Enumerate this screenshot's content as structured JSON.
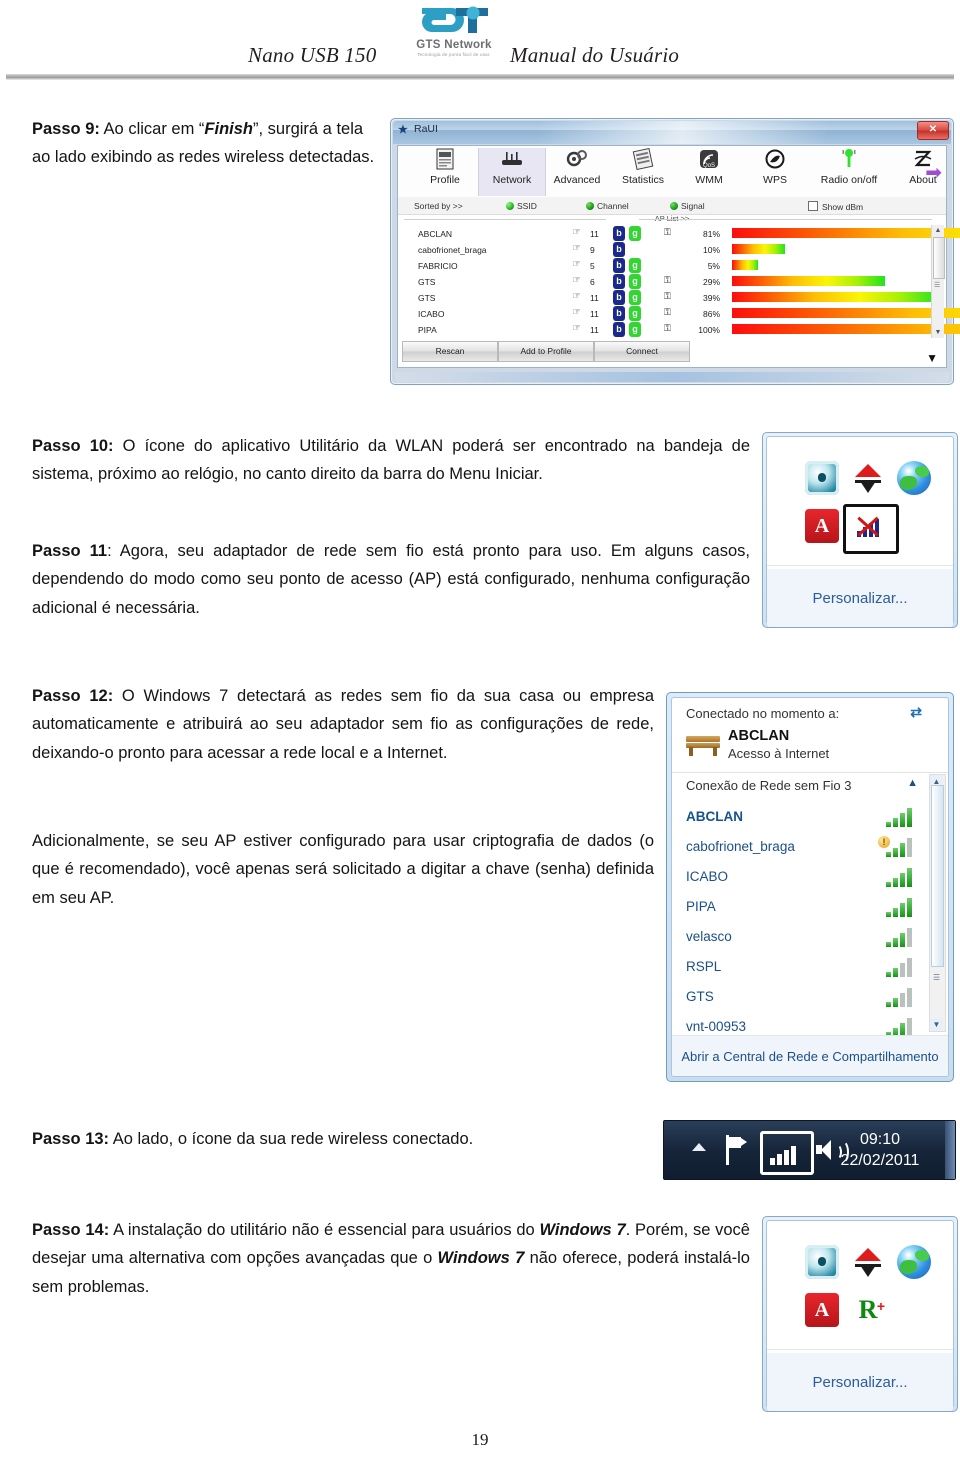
{
  "header": {
    "left_title": "Nano USB 150",
    "right_title": "Manual do Usuário",
    "logo_text": "GTS Network",
    "logo_tagline": "Tecnologia de ponta fácil de usar."
  },
  "steps": {
    "step9": {
      "label": "Passo 9:",
      "text_a": " Ao clicar em “",
      "emph": "Finish",
      "text_b": "”, surgirá a tela ao lado exibindo as redes wireless detectadas."
    },
    "step10": {
      "label": "Passo 10:",
      "text": " O ícone do aplicativo Utilitário da WLAN poderá ser encontrado na bandeja de sistema, próximo ao relógio, no canto direito da barra do Menu Iniciar."
    },
    "step11": {
      "label": "Passo 11",
      "text": ": Agora, seu adaptador de rede sem fio está pronto para uso. Em alguns casos, dependendo do modo como seu ponto de acesso (AP) está configurado, nenhuma configuração adicional é necessária."
    },
    "step12": {
      "label": "Passo 12:",
      "text": " O Windows 7 detectará as redes sem fio da sua casa ou empresa automaticamente e atribuirá ao seu adaptador sem fio as configurações de rede, deixando-o pronto para acessar a rede local e a Internet.",
      "para2": "Adicionalmente, se seu AP estiver configurado para usar criptografia de dados (o que é recomendado), você apenas será solicitado a digitar a chave (senha) definida em seu AP."
    },
    "step13": {
      "label": "Passo 13:",
      "text": " Ao lado, o ícone da sua rede wireless conectado."
    },
    "step14": {
      "label": "Passo 14:",
      "text_a": " A instalação do utilitário não é essencial para usuários do ",
      "emph1": "Windows 7",
      "text_b": ". Porém, se você desejar uma alternativa com opções avançadas que o ",
      "emph2": "Windows 7",
      "text_c": " não oferece, poderá instalá-lo sem problemas."
    }
  },
  "raui": {
    "window_title": "RaUI",
    "close_label": "✕",
    "toolbar": [
      {
        "label": "Profile",
        "icon": "profile-icon",
        "glyph": "☰",
        "selected": false
      },
      {
        "label": "Network",
        "icon": "network-icon",
        "glyph": "┳",
        "selected": true
      },
      {
        "label": "Advanced",
        "icon": "advanced-icon",
        "glyph": "⚙",
        "selected": false
      },
      {
        "label": "Statistics",
        "icon": "statistics-icon",
        "glyph": "▦",
        "selected": false
      },
      {
        "label": "WMM",
        "icon": "wmm-icon",
        "glyph": "◰",
        "selected": false
      },
      {
        "label": "WPS",
        "icon": "wps-icon",
        "glyph": "Ⓦ",
        "selected": false
      },
      {
        "label": "Radio on/off",
        "icon": "radio-icon",
        "glyph": "↑",
        "selected": false
      },
      {
        "label": "About",
        "icon": "about-icon",
        "glyph": "⑇",
        "selected": false
      }
    ],
    "toolbar_arrow_icon": "arrow-right-icon",
    "sort_label": "Sorted by >>",
    "sort_options": [
      "SSID",
      "Channel",
      "Signal"
    ],
    "show_dbm_label": "Show dBm",
    "ap_list_label": "AP List >>",
    "networks": [
      {
        "ssid": "ABCLAN",
        "channel": "11",
        "b": "b",
        "g": "g",
        "secured": true,
        "signal": "81%",
        "signal_value": 81
      },
      {
        "ssid": "cabofrionet_braga",
        "channel": "9",
        "b": "b",
        "g": "",
        "secured": false,
        "signal": "10%",
        "signal_value": 10
      },
      {
        "ssid": "FABRICIO",
        "channel": "5",
        "b": "b",
        "g": "g",
        "secured": false,
        "signal": "5%",
        "signal_value": 5
      },
      {
        "ssid": "GTS",
        "channel": "6",
        "b": "b",
        "g": "g",
        "secured": true,
        "signal": "29%",
        "signal_value": 29
      },
      {
        "ssid": "GTS",
        "channel": "11",
        "b": "b",
        "g": "g",
        "secured": true,
        "signal": "39%",
        "signal_value": 39
      },
      {
        "ssid": "ICABO",
        "channel": "11",
        "b": "b",
        "g": "g",
        "secured": true,
        "signal": "86%",
        "signal_value": 86
      },
      {
        "ssid": "PIPA",
        "channel": "11",
        "b": "b",
        "g": "g",
        "secured": true,
        "signal": "100%",
        "signal_value": 100
      }
    ],
    "buttons": [
      "Rescan",
      "Add to Profile",
      "Connect"
    ]
  },
  "tray_popup_top": {
    "link_label": "Personalizar...",
    "icons": [
      {
        "name": "nero-disc-icon",
        "type": "disc"
      },
      {
        "name": "download-manager-icon",
        "type": "download"
      },
      {
        "name": "internet-globe-icon",
        "type": "globe"
      },
      {
        "name": "adobe-icon",
        "type": "adobe",
        "letter": "A"
      },
      {
        "name": "wireless-disconnected-icon",
        "type": "netx",
        "highlighted": true
      }
    ]
  },
  "tray_popup_bottom": {
    "link_label": "Personalizar...",
    "icons": [
      {
        "name": "nero-disc-icon",
        "type": "disc"
      },
      {
        "name": "download-manager-icon",
        "type": "download"
      },
      {
        "name": "internet-globe-icon",
        "type": "globe"
      },
      {
        "name": "adobe-icon",
        "type": "adobe",
        "letter": "A"
      },
      {
        "name": "ralink-utility-icon",
        "type": "rplus",
        "letter": "R"
      }
    ]
  },
  "win7_panel": {
    "connected_label": "Conectado no momento a:",
    "connected_ssid": "ABCLAN",
    "connected_status": "Acesso à Internet",
    "group_label": "Conexão de Rede sem Fio 3",
    "networks": [
      {
        "ssid": "ABCLAN",
        "bars": 4,
        "current": true,
        "warning": false
      },
      {
        "ssid": "cabofrionet_braga",
        "bars": 3,
        "current": false,
        "warning": true
      },
      {
        "ssid": "ICABO",
        "bars": 4,
        "current": false,
        "warning": false
      },
      {
        "ssid": "PIPA",
        "bars": 4,
        "current": false,
        "warning": false
      },
      {
        "ssid": "velasco",
        "bars": 3,
        "current": false,
        "warning": false
      },
      {
        "ssid": "RSPL",
        "bars": 2,
        "current": false,
        "warning": false
      },
      {
        "ssid": "GTS",
        "bars": 2,
        "current": false,
        "warning": false
      },
      {
        "ssid": "vnt-00953",
        "bars": 3,
        "current": false,
        "warning": false
      }
    ],
    "footer_link": "Abrir a Central de Rede e Compartilhamento",
    "refresh_icon": "refresh-icon",
    "collapse_icon": "chevron-up-icon"
  },
  "taskbar": {
    "time": "09:10",
    "date": "22/02/2011",
    "show_hidden_icon": "chevron-up-icon",
    "action_center_icon": "flag-icon",
    "network_icon": "wifi-signal-icon",
    "volume_icon": "speaker-icon"
  },
  "page_number": "19",
  "colors": {
    "accent": "#1b4f8a",
    "brand": "#2a8fa8",
    "signal_strong": "#21e321",
    "signal_weak": "#fc0d0d"
  }
}
